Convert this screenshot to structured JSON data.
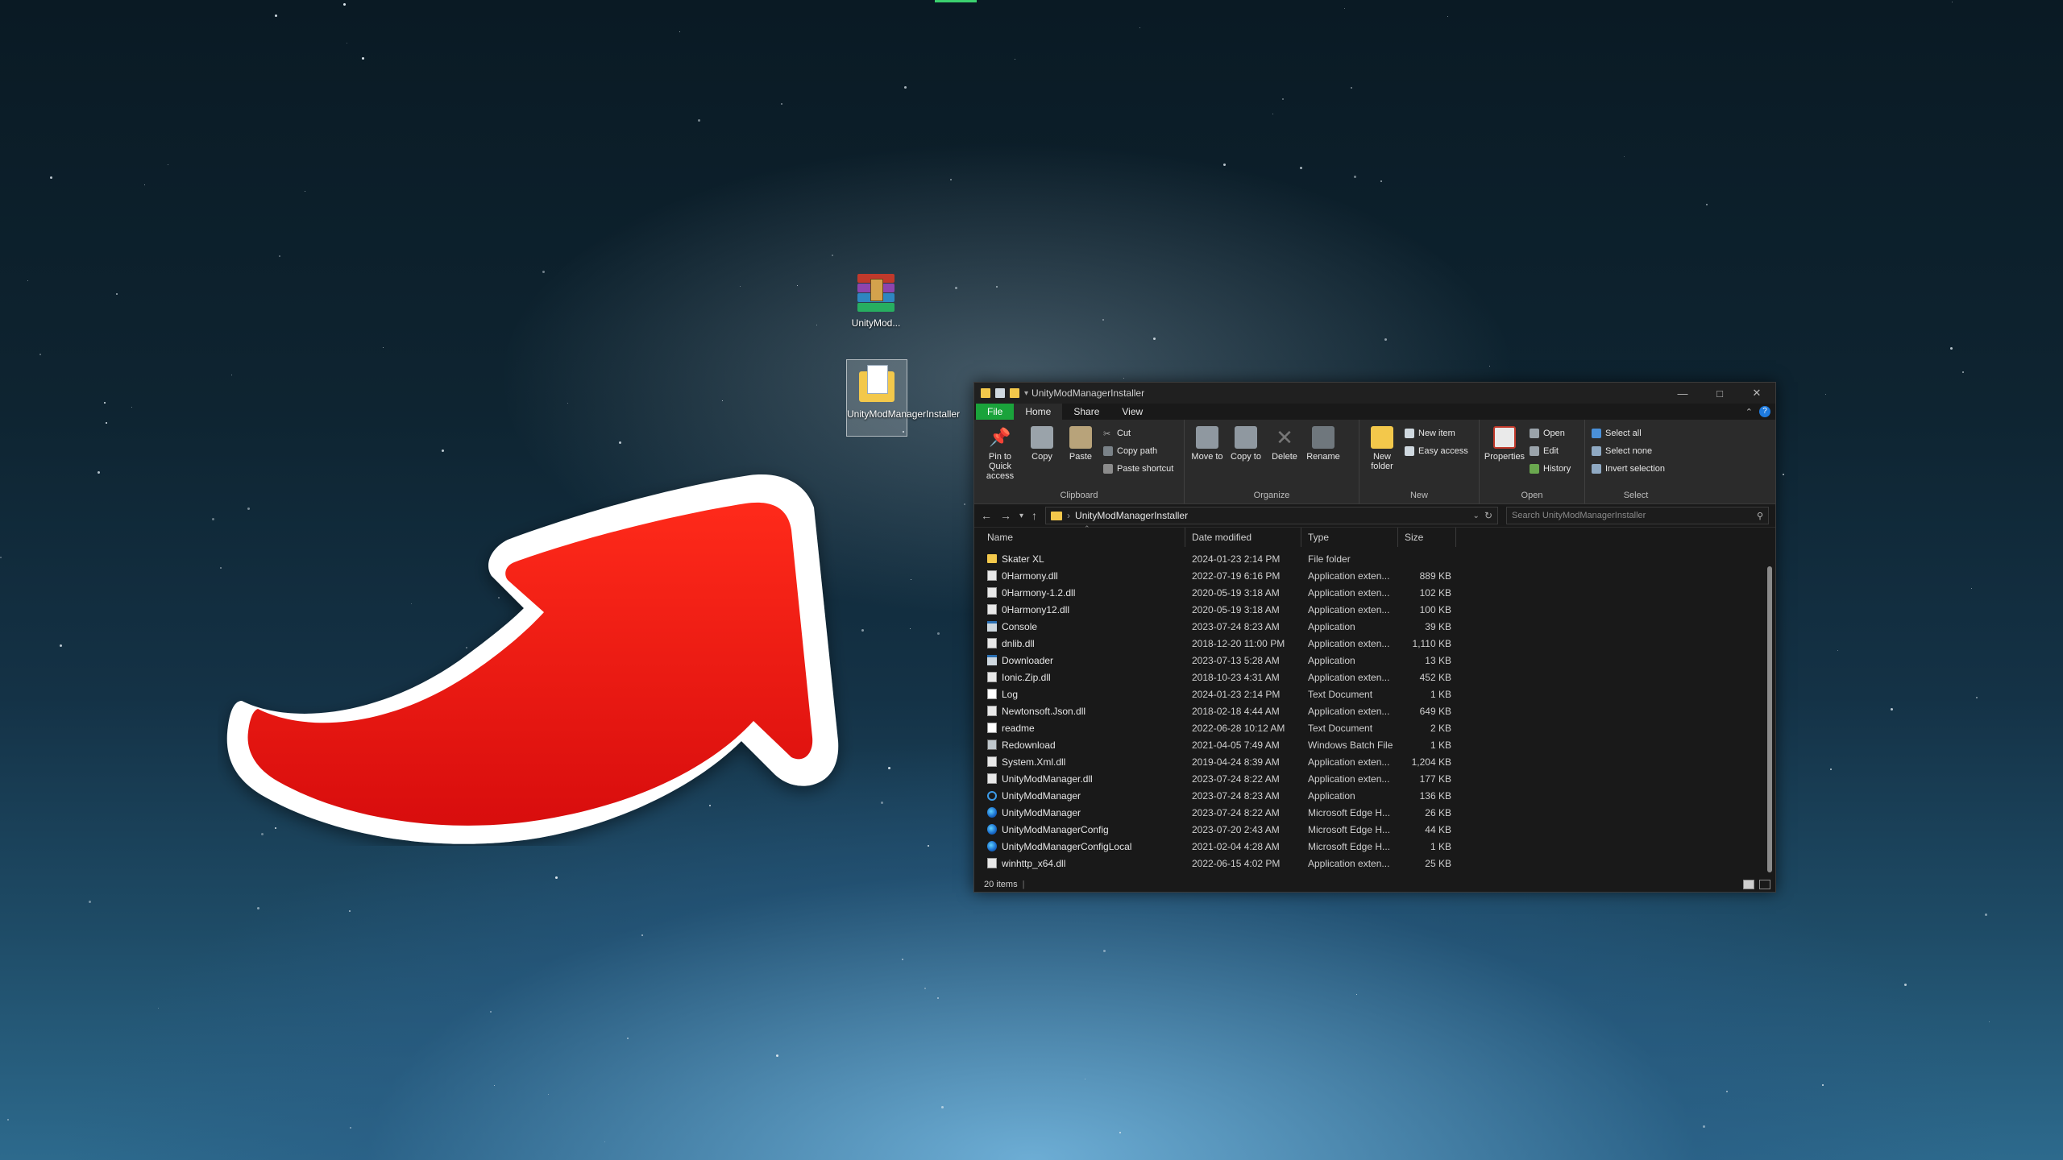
{
  "desktop": {
    "icons": [
      {
        "label": "UnityMod..."
      },
      {
        "label": "UnityModManagerInstaller"
      }
    ]
  },
  "window": {
    "title": "UnityModManagerInstaller",
    "tabs": {
      "file": "File",
      "home": "Home",
      "share": "Share",
      "view": "View"
    },
    "ribbon": {
      "clipboard": {
        "pin": "Pin to Quick access",
        "copy": "Copy",
        "paste": "Paste",
        "cut": "Cut",
        "copy_path": "Copy path",
        "paste_shortcut": "Paste shortcut",
        "label": "Clipboard"
      },
      "organize": {
        "move_to": "Move to",
        "copy_to": "Copy to",
        "delete": "Delete",
        "rename": "Rename",
        "label": "Organize"
      },
      "new": {
        "new_folder": "New folder",
        "new_item": "New item",
        "easy_access": "Easy access",
        "label": "New"
      },
      "open": {
        "properties": "Properties",
        "open": "Open",
        "edit": "Edit",
        "history": "History",
        "label": "Open"
      },
      "select": {
        "select_all": "Select all",
        "select_none": "Select none",
        "invert": "Invert selection",
        "label": "Select"
      }
    },
    "address": {
      "path": "UnityModManagerInstaller",
      "search_placeholder": "Search UnityModManagerInstaller"
    },
    "columns": {
      "name": "Name",
      "date": "Date modified",
      "type": "Type",
      "size": "Size"
    },
    "files": [
      {
        "name": "Skater XL",
        "date": "2024-01-23 2:14 PM",
        "type": "File folder",
        "size": "",
        "icon": "folder"
      },
      {
        "name": "0Harmony.dll",
        "date": "2022-07-19 6:16 PM",
        "type": "Application exten...",
        "size": "889 KB",
        "icon": "dll"
      },
      {
        "name": "0Harmony-1.2.dll",
        "date": "2020-05-19 3:18 AM",
        "type": "Application exten...",
        "size": "102 KB",
        "icon": "dll"
      },
      {
        "name": "0Harmony12.dll",
        "date": "2020-05-19 3:18 AM",
        "type": "Application exten...",
        "size": "100 KB",
        "icon": "dll"
      },
      {
        "name": "Console",
        "date": "2023-07-24 8:23 AM",
        "type": "Application",
        "size": "39 KB",
        "icon": "app"
      },
      {
        "name": "dnlib.dll",
        "date": "2018-12-20 11:00 PM",
        "type": "Application exten...",
        "size": "1,110 KB",
        "icon": "dll"
      },
      {
        "name": "Downloader",
        "date": "2023-07-13 5:28 AM",
        "type": "Application",
        "size": "13 KB",
        "icon": "app"
      },
      {
        "name": "Ionic.Zip.dll",
        "date": "2018-10-23 4:31 AM",
        "type": "Application exten...",
        "size": "452 KB",
        "icon": "dll"
      },
      {
        "name": "Log",
        "date": "2024-01-23 2:14 PM",
        "type": "Text Document",
        "size": "1 KB",
        "icon": "txt"
      },
      {
        "name": "Newtonsoft.Json.dll",
        "date": "2018-02-18 4:44 AM",
        "type": "Application exten...",
        "size": "649 KB",
        "icon": "dll"
      },
      {
        "name": "readme",
        "date": "2022-06-28 10:12 AM",
        "type": "Text Document",
        "size": "2 KB",
        "icon": "txt"
      },
      {
        "name": "Redownload",
        "date": "2021-04-05 7:49 AM",
        "type": "Windows Batch File",
        "size": "1 KB",
        "icon": "bat"
      },
      {
        "name": "System.Xml.dll",
        "date": "2019-04-24 8:39 AM",
        "type": "Application exten...",
        "size": "1,204 KB",
        "icon": "dll"
      },
      {
        "name": "UnityModManager.dll",
        "date": "2023-07-24 8:22 AM",
        "type": "Application exten...",
        "size": "177 KB",
        "icon": "dll"
      },
      {
        "name": "UnityModManager",
        "date": "2023-07-24 8:23 AM",
        "type": "Application",
        "size": "136 KB",
        "icon": "gear"
      },
      {
        "name": "UnityModManager",
        "date": "2023-07-24 8:22 AM",
        "type": "Microsoft Edge H...",
        "size": "26 KB",
        "icon": "edge"
      },
      {
        "name": "UnityModManagerConfig",
        "date": "2023-07-20 2:43 AM",
        "type": "Microsoft Edge H...",
        "size": "44 KB",
        "icon": "edge"
      },
      {
        "name": "UnityModManagerConfigLocal",
        "date": "2021-02-04 4:28 AM",
        "type": "Microsoft Edge H...",
        "size": "1 KB",
        "icon": "edge"
      },
      {
        "name": "winhttp_x64.dll",
        "date": "2022-06-15 4:02 PM",
        "type": "Application exten...",
        "size": "25 KB",
        "icon": "dll"
      }
    ],
    "status": "20 items"
  }
}
